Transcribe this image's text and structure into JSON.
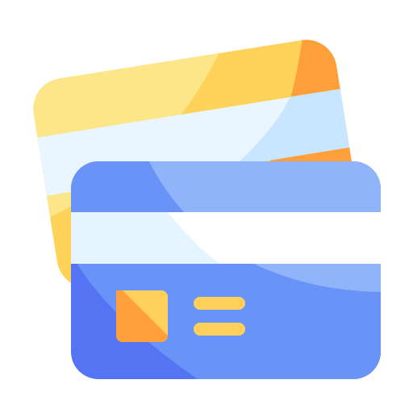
{
  "illustration": {
    "subject": "credit-cards-icon",
    "back_card": {
      "icon": "credit-card-icon",
      "colors": {
        "light_yellow": "#FDE68A",
        "yellow": "#FFD25A",
        "orange": "#FF9F3A",
        "stripe_light": "#EAF6FF",
        "stripe_blue": "#C8E6FF"
      }
    },
    "front_card": {
      "icon": "credit-card-icon",
      "colors": {
        "blue_dark": "#5474F4",
        "blue_mid": "#6A93F7",
        "blue_light": "#8FB4FA",
        "stripe_white": "#FFFFFF",
        "stripe_light": "#E6F4FF",
        "chip_yellow": "#FFD05A",
        "chip_orange": "#FF9F3A",
        "lines_yellow": "#FFD05A"
      }
    }
  }
}
